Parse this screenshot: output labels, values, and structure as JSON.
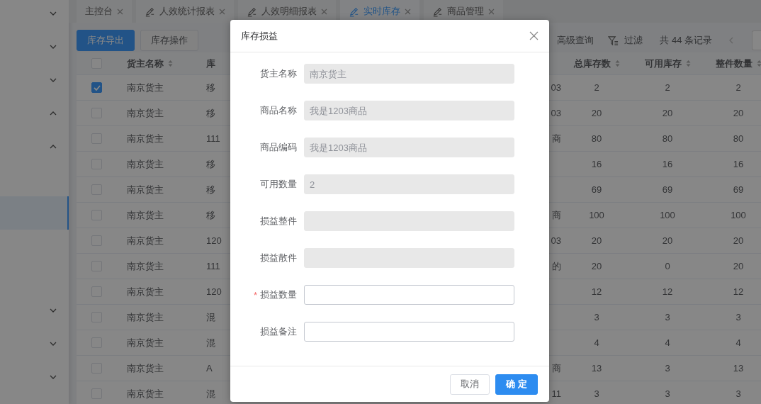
{
  "sidebar": {
    "items": [
      {
        "kind": "group",
        "expanded": false
      },
      {
        "kind": "group",
        "expanded": false
      },
      {
        "kind": "group",
        "expanded": false
      },
      {
        "kind": "group",
        "expanded": true
      },
      {
        "kind": "group",
        "expanded": true
      },
      {
        "kind": "link",
        "selected": false
      },
      {
        "kind": "link",
        "selected": true
      },
      {
        "kind": "link",
        "selected": false
      },
      {
        "kind": "group",
        "expanded": false
      },
      {
        "kind": "group",
        "expanded": false
      },
      {
        "kind": "group",
        "expanded": false
      }
    ]
  },
  "tabs": [
    {
      "label": "主控台",
      "icon": false,
      "selected": false
    },
    {
      "label": "人效统计报表",
      "icon": true,
      "selected": false
    },
    {
      "label": "人效明细报表",
      "icon": true,
      "selected": false
    },
    {
      "label": "实时库存",
      "icon": true,
      "selected": true
    },
    {
      "label": "商品管理",
      "icon": true,
      "selected": false
    }
  ],
  "toolbar": {
    "buttons": [
      {
        "label": "库存导出",
        "primary": true
      },
      {
        "label": "库存操作",
        "primary": false
      }
    ],
    "advanced_search": "高级查询",
    "filter": "过滤",
    "record_count": "共 44 条记录"
  },
  "table": {
    "select_all": false,
    "columns": [
      "货主名称",
      "库",
      "",
      "总库存数",
      "可用库存",
      "整件数量"
    ],
    "rows": [
      {
        "selected": true,
        "cells": [
          "南京货主",
          "移",
          "03",
          "2",
          "2",
          "2"
        ]
      },
      {
        "selected": false,
        "cells": [
          "南京货主",
          "移",
          "03",
          "20",
          "20",
          "20"
        ]
      },
      {
        "selected": false,
        "cells": [
          "南京货主",
          "111",
          "商",
          "80",
          "80",
          "80"
        ]
      },
      {
        "selected": false,
        "cells": [
          "南京货主",
          "移",
          "",
          "16",
          "16",
          "16"
        ]
      },
      {
        "selected": false,
        "cells": [
          "南京货主",
          "移",
          "",
          "69",
          "69",
          "69"
        ]
      },
      {
        "selected": false,
        "cells": [
          "南京货主",
          "移",
          "商",
          "100",
          "100",
          "100"
        ]
      },
      {
        "selected": false,
        "cells": [
          "南京货主",
          "120",
          "03",
          "20",
          "20",
          "20"
        ]
      },
      {
        "selected": false,
        "cells": [
          "南京货主",
          "111",
          "的",
          "20",
          "0",
          "20"
        ]
      },
      {
        "selected": false,
        "cells": [
          "南京货主",
          "120",
          "",
          "12",
          "12",
          "12"
        ]
      },
      {
        "selected": false,
        "cells": [
          "南京货主",
          "混",
          "",
          "3",
          "3",
          "3"
        ]
      },
      {
        "selected": false,
        "cells": [
          "南京货主",
          "混",
          "",
          "4",
          "4",
          "4"
        ]
      },
      {
        "selected": false,
        "cells": [
          "南京货主",
          "A",
          "商",
          "13",
          "3",
          "13"
        ]
      },
      {
        "selected": false,
        "cells": [
          "南京货主",
          "混",
          "11",
          "3",
          "3",
          "3"
        ]
      }
    ]
  },
  "dialog": {
    "title": "库存损益",
    "required_mark": "*",
    "fields": [
      {
        "label": "货主名称",
        "placeholder": "南京货主",
        "disabled": true,
        "required": false
      },
      {
        "label": "商品名称",
        "placeholder": "我是1203商品",
        "disabled": true,
        "required": false
      },
      {
        "label": "商品编码",
        "placeholder": "我是1203商品",
        "disabled": true,
        "required": false
      },
      {
        "label": "可用数量",
        "placeholder": "2",
        "disabled": true,
        "required": false
      },
      {
        "label": "损益整件",
        "disabled": true,
        "required": false
      },
      {
        "label": "损益散件",
        "disabled": true,
        "required": false
      },
      {
        "label": "损益数量",
        "disabled": false,
        "required": true
      },
      {
        "label": "损益备注",
        "disabled": false,
        "required": false
      }
    ],
    "buttons": [
      {
        "label": "取消",
        "primary": false
      },
      {
        "label": "确 定",
        "primary": true
      }
    ]
  }
}
